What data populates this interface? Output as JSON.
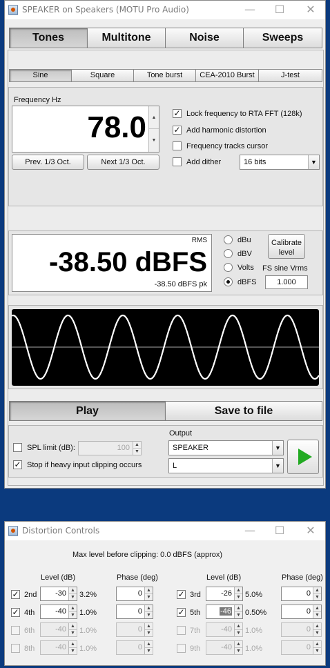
{
  "main_window": {
    "title": "SPEAKER on Speakers (MOTU Pro Audio)",
    "window_controls": {
      "minimize": "—",
      "maximize": "☐",
      "close": "✕"
    },
    "mode_tabs": [
      "Tones",
      "Multitone",
      "Noise",
      "Sweeps"
    ],
    "selected_mode_tab": "Tones",
    "tone_tabs": [
      "Sine",
      "Square",
      "Tone burst",
      "CEA-2010 Burst",
      "J-test"
    ],
    "selected_tone_tab": "Sine",
    "frequency": {
      "label": "Frequency Hz",
      "value": "78.0",
      "prev_button": "Prev. 1/3 Oct.",
      "next_button": "Next 1/3 Oct."
    },
    "options": {
      "lock_rta": {
        "label": "Lock frequency to RTA FFT (128k)",
        "checked": true
      },
      "harmonic": {
        "label": "Add harmonic distortion",
        "checked": true
      },
      "tracks_cursor": {
        "label": "Frequency tracks cursor",
        "checked": false
      },
      "dither": {
        "label": "Add dither",
        "checked": false,
        "bits": "16 bits"
      }
    },
    "level": {
      "rms_label": "RMS",
      "value": "-38.50 dBFS",
      "peak": "-38.50 dBFS pk",
      "units": [
        "dBu",
        "dBV",
        "Volts",
        "dBFS"
      ],
      "selected_unit": "dBFS",
      "calibrate_button": "Calibrate level",
      "fs_label": "FS sine Vrms",
      "fs_value": "1.000"
    },
    "waveform": {
      "type": "sine",
      "cycles": 5.6,
      "color": "#ffffff",
      "background": "#000000",
      "center_line": "#aaaaaa"
    },
    "play_button": "Play",
    "save_button": "Save to file",
    "spl_limit": {
      "label": "SPL limit (dB):",
      "checked": false,
      "value": "100"
    },
    "stop_clipping": {
      "label": "Stop if heavy input clipping occurs",
      "checked": true
    },
    "output": {
      "label": "Output",
      "device": "SPEAKER",
      "channel": "L"
    },
    "play_icon_color": "#22aa22"
  },
  "distortion_window": {
    "title": "Distortion Controls",
    "window_controls": {
      "minimize": "—",
      "maximize": "☐",
      "close": "✕"
    },
    "max_level": "Max level before clipping: 0.0 dBFS (approx)",
    "col_level": "Level (dB)",
    "col_phase": "Phase (deg)",
    "harmonics_left": [
      {
        "name": "2nd",
        "checked": true,
        "level": "-30",
        "pct": "3.2%",
        "phase": "0",
        "enabled": true
      },
      {
        "name": "4th",
        "checked": true,
        "level": "-40",
        "pct": "1.0%",
        "phase": "0",
        "enabled": true
      },
      {
        "name": "6th",
        "checked": false,
        "level": "-40",
        "pct": "1.0%",
        "phase": "0",
        "enabled": false
      },
      {
        "name": "8th",
        "checked": false,
        "level": "-40",
        "pct": "1.0%",
        "phase": "0",
        "enabled": false
      }
    ],
    "harmonics_right": [
      {
        "name": "3rd",
        "checked": true,
        "level": "-26",
        "pct": "5.0%",
        "phase": "0",
        "enabled": true
      },
      {
        "name": "5th",
        "checked": true,
        "level": "-46",
        "pct": "0.50%",
        "phase": "0",
        "enabled": true,
        "level_selected": true
      },
      {
        "name": "7th",
        "checked": false,
        "level": "-40",
        "pct": "1.0%",
        "phase": "0",
        "enabled": false
      },
      {
        "name": "9th",
        "checked": false,
        "level": "-40",
        "pct": "1.0%",
        "phase": "0",
        "enabled": false
      }
    ]
  }
}
